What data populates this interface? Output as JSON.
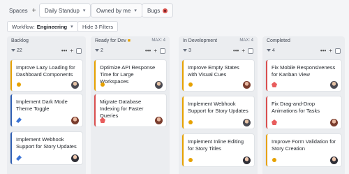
{
  "tabs": [
    {
      "label": "Spaces",
      "icon": "plus-icon"
    },
    {
      "label": "Daily Standup",
      "icon": "chevron-down-icon"
    },
    {
      "label": "Owned by me",
      "icon": "chevron-down-icon"
    },
    {
      "label": "Bugs",
      "icon": "bug-icon"
    }
  ],
  "toolbar": {
    "workflow_label": "Workflow:",
    "workflow_value": "Engineering",
    "filters_button": "Hide 3 Filters"
  },
  "columns": [
    {
      "name": "Backlog",
      "max": "",
      "count": "22",
      "cards": [
        {
          "title": "Improve Lazy Loading for Dashboard Components",
          "type": "task"
        },
        {
          "title": "Implement Dark Mode Theme Toggle",
          "type": "story"
        },
        {
          "title": "Implement Webhook Support for Story Updates",
          "type": "story"
        }
      ]
    },
    {
      "name": "Ready for Dev",
      "max": "MAX: 4",
      "count": "2",
      "cards": [
        {
          "title": "Optimize API Response Time for Large Workspaces",
          "type": "task"
        },
        {
          "title": "Migrate Database Indexing for Faster Queries",
          "type": "bug"
        }
      ]
    },
    {
      "name": "In Development",
      "max": "MAX: 4",
      "count": "3",
      "cards": [
        {
          "title": "Improve Empty States with Visual Cues",
          "type": "task"
        },
        {
          "title": "Implement Webhook Support for Story Updates",
          "type": "task"
        },
        {
          "title": "Implement Inline Editing for Story Titles",
          "type": "task"
        }
      ]
    },
    {
      "name": "Completed",
      "max": "",
      "count": "4",
      "cards": [
        {
          "title": "Fix Mobile Responsiveness for Kanban View",
          "type": "bug"
        },
        {
          "title": "Fix Drag-and-Drop Animations for Tasks",
          "type": "bug"
        },
        {
          "title": "Improve Form Validation for Story Creation",
          "type": "task"
        }
      ]
    }
  ],
  "colors": {
    "task": "#e6a100",
    "bug": "#d94f4f",
    "story": "#2f5fb3",
    "background": "#f4f5f7"
  }
}
